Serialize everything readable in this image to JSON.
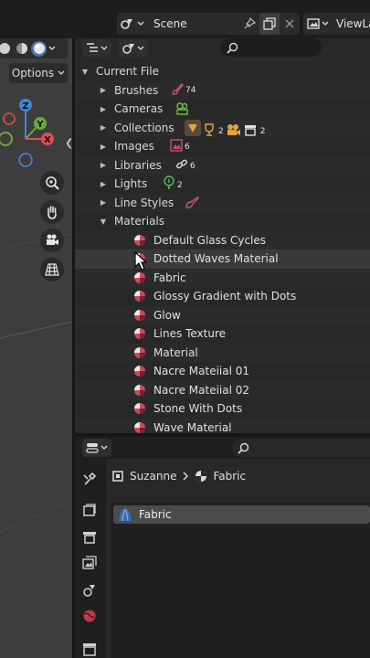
{
  "topbar": {
    "scene_name": "Scene",
    "viewlayer_name": "ViewLa"
  },
  "viewport": {
    "options_label": "Options",
    "gizmo_axes": {
      "z": "Z",
      "y": "Y",
      "x": "X"
    },
    "colors": {
      "background": "#3d3d3d",
      "x_axis": "#e64b50",
      "y_axis": "#6ca934",
      "z_axis": "#3f85e0"
    }
  },
  "outliner": {
    "search_placeholder": "",
    "root": "Current File",
    "categories": [
      {
        "label": "Brushes",
        "count": "74"
      },
      {
        "label": "Cameras",
        "count": ""
      },
      {
        "label": "Collections",
        "counts": [
          "2",
          "2"
        ]
      },
      {
        "label": "Images",
        "count": "6"
      },
      {
        "label": "Libraries",
        "count": "6"
      },
      {
        "label": "Lights",
        "count": "2"
      },
      {
        "label": "Line Styles",
        "count": ""
      },
      {
        "label": "Materials",
        "count": ""
      }
    ],
    "materials": [
      "Default Glass Cycles",
      "Dotted Waves Material",
      "Fabric",
      "Glossy Gradient with Dots",
      "Glow",
      "Lines Texture",
      "Material",
      "Nacre Mateiial 01",
      "Nacre Mateiial 02",
      "Stone With Dots",
      "Wave Material"
    ],
    "hovered_index": 1
  },
  "properties": {
    "object_name": "Suzanne",
    "material_name": "Fabric",
    "slot_label": "Fabric",
    "active_tab": "material"
  },
  "colors": {
    "material_icon": "#d04a5c",
    "brush_icon": "#c94d86",
    "camera_icon": "#6cc04a",
    "collection_icon": "#e3a145",
    "light_icon": "#4fc06d"
  }
}
